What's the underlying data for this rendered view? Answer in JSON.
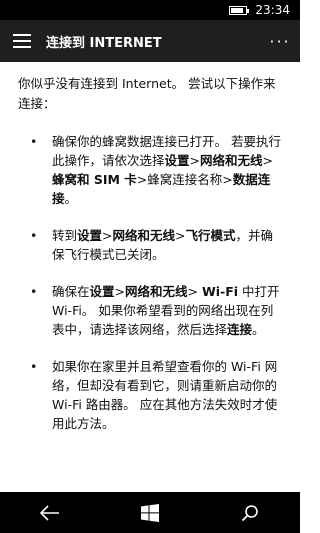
{
  "status": {
    "time": "23:34",
    "battery_level": 0.85
  },
  "app_bar": {
    "title": "连接到 INTERNET",
    "more_label": "···"
  },
  "content": {
    "intro": "你似乎没有连接到 Internet。 尝试以下操作来连接：",
    "bullet_symbol": "•",
    "steps": [
      {
        "parts": [
          "确保你的蜂窝数据连接已打开。 若要执行此操作，请依次选择",
          "设置",
          ">",
          "网络和无线",
          ">",
          "蜂窝和 SIM 卡",
          ">蜂窝连接名称>",
          "数据连接",
          "。"
        ]
      },
      {
        "parts": [
          "转到",
          "设置",
          ">",
          "网络和无线",
          ">",
          "飞行模式",
          "，并确保飞行模式已关闭。"
        ]
      },
      {
        "parts": [
          "确保在",
          "设置",
          ">",
          "网络和无线",
          "> ",
          "Wi-Fi",
          " 中打开 Wi-Fi。 如果你希望看到的网络出现在列表中，请选择该网络，然后选择",
          "连接",
          "。"
        ]
      },
      {
        "parts": [
          "如果你在家里并且希望查看你的 Wi-Fi 网络，但却没有看到它，则请重新启动你的 Wi-Fi 路由器。 应在其他方法失效时才使用此方法。"
        ]
      }
    ]
  },
  "nav": {
    "back_icon": "back-arrow-icon",
    "windows_icon": "windows-logo-icon",
    "search_icon": "search-icon"
  }
}
